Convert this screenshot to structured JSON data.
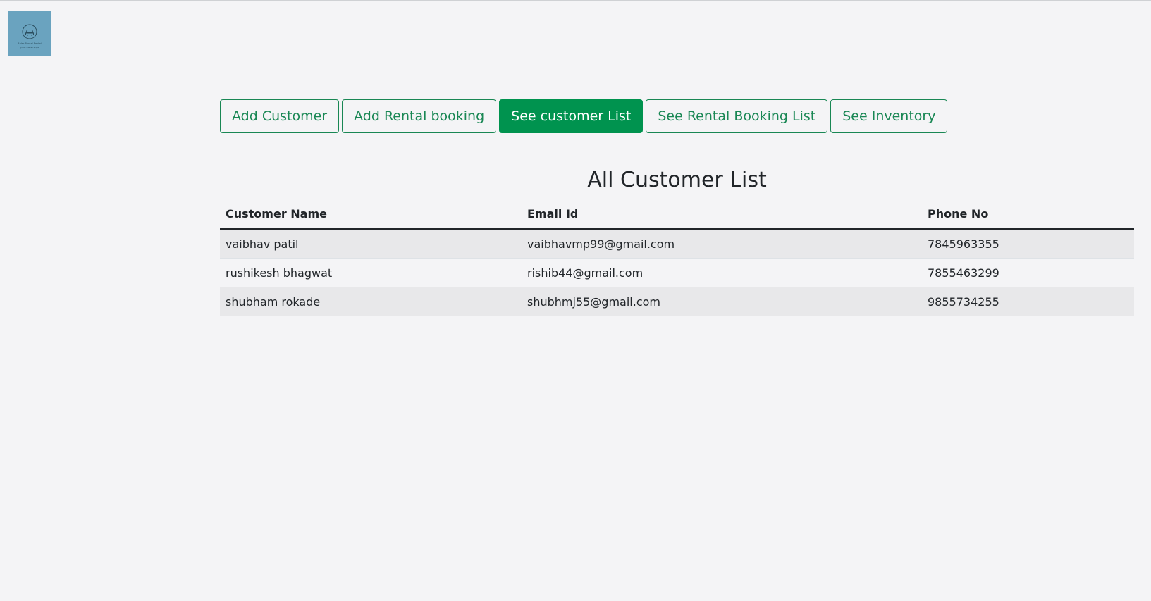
{
  "logo": {
    "icon": "car-icon",
    "title_text": "Rider Rental Rental",
    "sub_text": "your ride arrange"
  },
  "nav": {
    "buttons": [
      {
        "label": "Add Customer",
        "active": false
      },
      {
        "label": "Add Rental booking",
        "active": false
      },
      {
        "label": "See customer List",
        "active": true
      },
      {
        "label": "See Rental Booking List",
        "active": false
      },
      {
        "label": "See Inventory",
        "active": false
      }
    ]
  },
  "page": {
    "title": "All Customer List"
  },
  "table": {
    "headers": [
      "Customer Name",
      "Email Id",
      "Phone No"
    ],
    "rows": [
      [
        "vaibhav patil",
        "vaibhavmp99@gmail.com",
        "7845963355"
      ],
      [
        "rushikesh bhagwat",
        "rishib44@gmail.com",
        "7855463299"
      ],
      [
        "shubham rokade",
        "shubhmj55@gmail.com",
        "9855734255"
      ]
    ]
  },
  "colors": {
    "accent": "#198754",
    "active_bg": "#00934f",
    "page_bg": "#f4f4f6",
    "striped_row": "#e8e8ea"
  }
}
